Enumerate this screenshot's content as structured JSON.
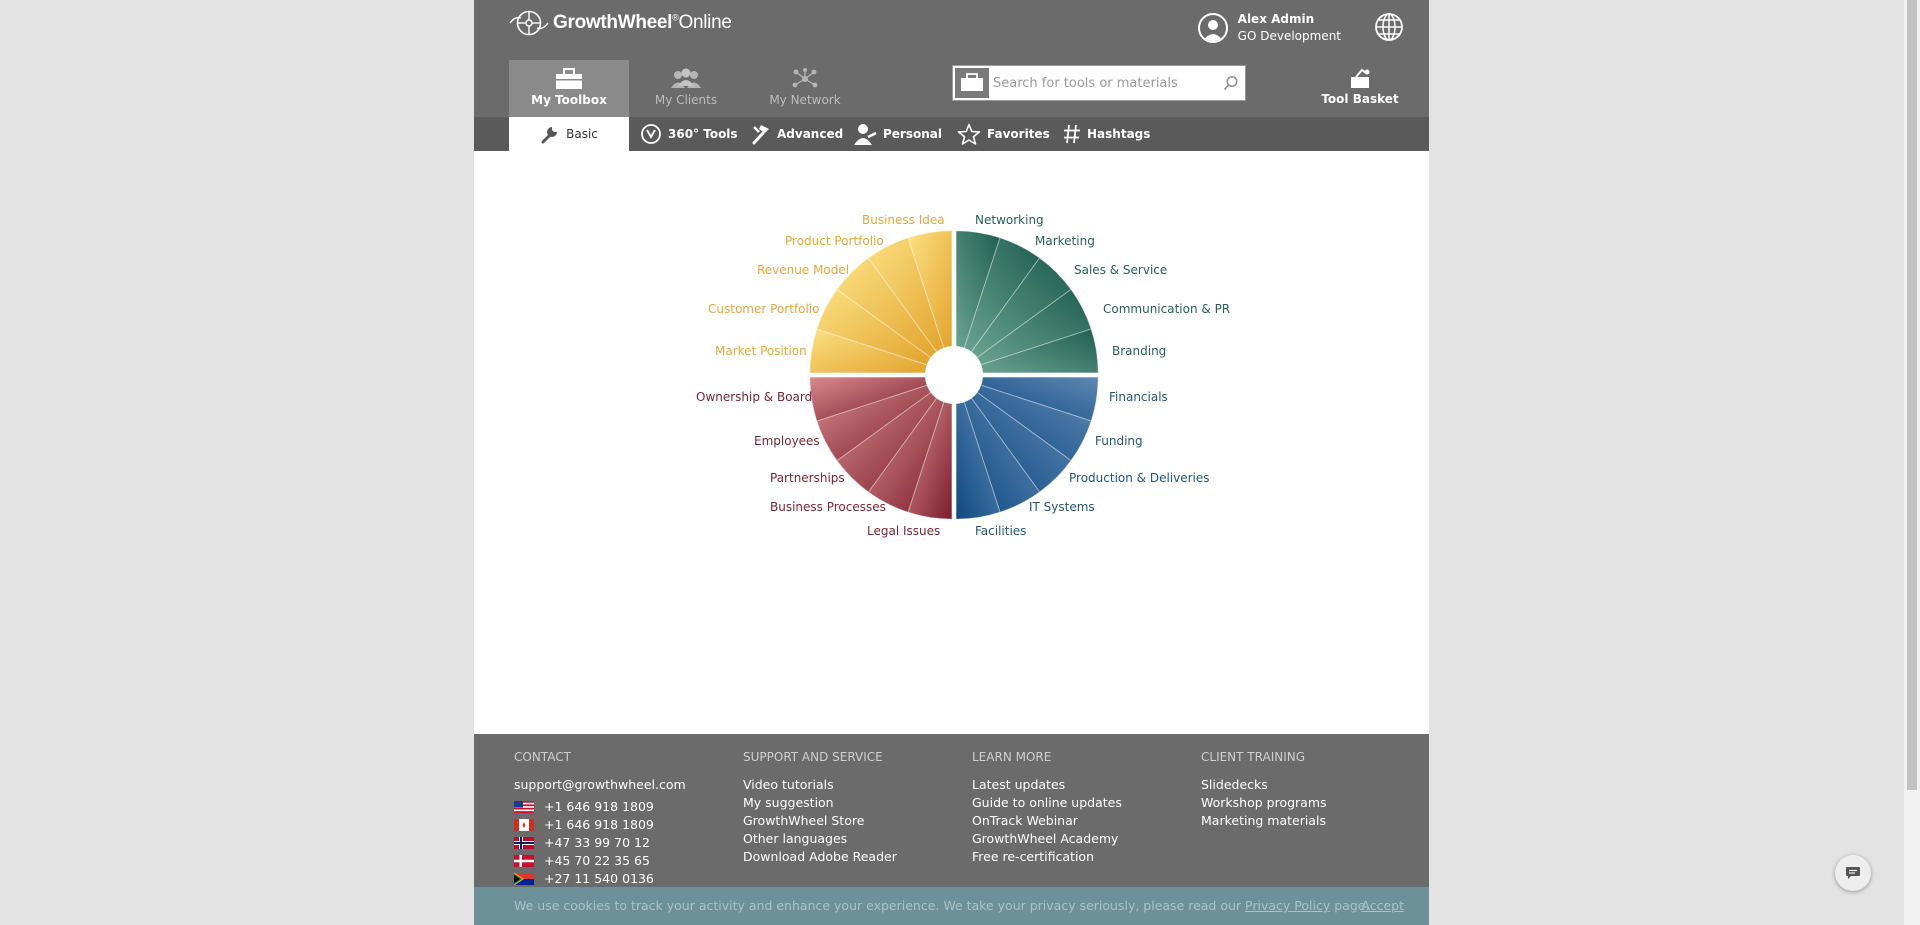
{
  "header": {
    "brand_bold": "GrowthWheel",
    "brand_light": "Online",
    "user_name": "Alex Admin",
    "user_org": "GO Development",
    "main_tabs": [
      {
        "label": "My Toolbox",
        "icon": "toolbox-icon",
        "active": true
      },
      {
        "label": "My Clients",
        "icon": "people-icon",
        "active": false
      },
      {
        "label": "My Network",
        "icon": "network-icon",
        "active": false
      }
    ],
    "search_placeholder": "Search for tools or materials",
    "tool_basket_label": "Tool Basket"
  },
  "subnav": [
    {
      "label": "Basic",
      "icon": "wrench-icon",
      "active": true
    },
    {
      "label": "360° Tools",
      "icon": "360-icon",
      "active": false
    },
    {
      "label": "Advanced",
      "icon": "tools-icon",
      "active": false
    },
    {
      "label": "Personal",
      "icon": "person-icon",
      "active": false
    },
    {
      "label": "Favorites",
      "icon": "star-icon",
      "active": false
    },
    {
      "label": "Hashtags",
      "icon": "hashtag-icon",
      "active": false
    }
  ],
  "wheel": {
    "colors": {
      "yellow": "#e6aa36",
      "green": "#2e6e60",
      "red": "#8e2a3a",
      "blue": "#1f5a8a"
    },
    "quadrants": [
      {
        "name": "yellow",
        "items": [
          "Market Position",
          "Customer Portfolio",
          "Revenue Model",
          "Product Portfolio",
          "Business Idea"
        ]
      },
      {
        "name": "green",
        "items": [
          "Networking",
          "Marketing",
          "Sales & Service",
          "Communication & PR",
          "Branding"
        ]
      },
      {
        "name": "blue",
        "items": [
          "Financials",
          "Funding",
          "Production & Deliveries",
          "IT Systems",
          "Facilities"
        ]
      },
      {
        "name": "red",
        "items": [
          "Legal Issues",
          "Business Processes",
          "Partnerships",
          "Employees",
          "Ownership & Board"
        ]
      }
    ]
  },
  "footer": {
    "contact": {
      "heading": "CONTACT",
      "email": "support@growthwheel.com",
      "phones": [
        {
          "flag": "us-flag-icon",
          "number": "+1 646 918 1809"
        },
        {
          "flag": "ca-flag-icon",
          "number": "+1 646 918 1809"
        },
        {
          "flag": "no-flag-icon",
          "number": "+47 33 99 70 12"
        },
        {
          "flag": "dk-flag-icon",
          "number": "+45 70 22 35 65"
        },
        {
          "flag": "za-flag-icon",
          "number": "+27 11 540 0136"
        }
      ]
    },
    "support": {
      "heading": "SUPPORT AND SERVICE",
      "items": [
        "Video tutorials",
        "My suggestion",
        "GrowthWheel Store",
        "Other languages",
        "Download Adobe Reader"
      ]
    },
    "learn": {
      "heading": "LEARN MORE",
      "items": [
        "Latest updates",
        "Guide to online updates",
        "OnTrack Webinar",
        "GrowthWheel Academy",
        "Free re-certification"
      ]
    },
    "training": {
      "heading": "CLIENT TRAINING",
      "items": [
        "Slidedecks",
        "Workshop programs",
        "Marketing materials"
      ]
    }
  },
  "cookie": {
    "message": "We use cookies to track your activity and enhance your experience. We take your privacy seriously, please read our",
    "policy_link": "Privacy Policy",
    "suffix": "page.",
    "accept": "Accept"
  }
}
